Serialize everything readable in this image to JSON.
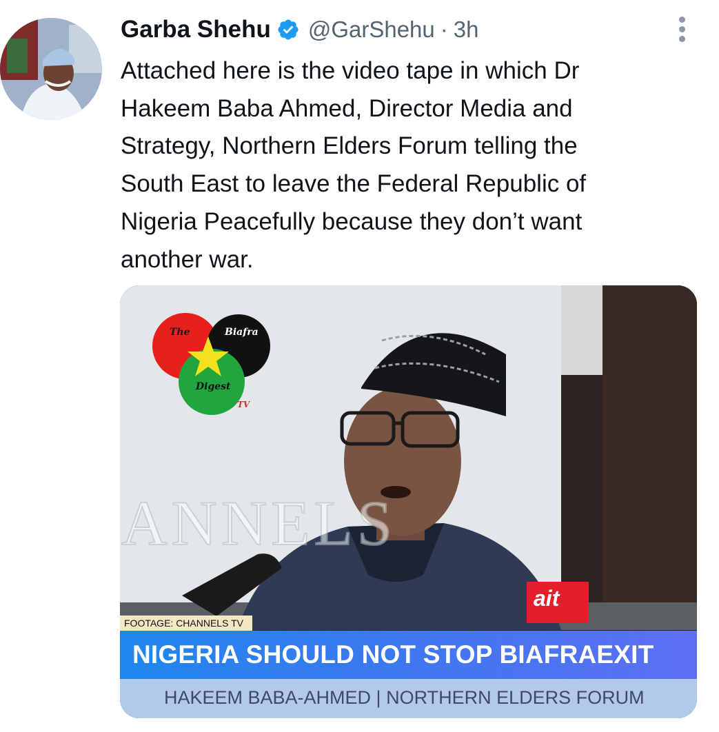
{
  "author": {
    "name": "Garba Shehu",
    "handle": "@GarShehu",
    "separator": "·",
    "time": "3h",
    "verified_icon": "verified-badge-icon"
  },
  "tweet": {
    "lines": [
      "Attached here is the video tape in which Dr",
      "Hakeem Baba Ahmed, Director Media and",
      "Strategy, Northern Elders Forum telling the",
      "South East to leave the Federal Republic of",
      "Nigeria Peacefully because they don’t want",
      "another war."
    ]
  },
  "media": {
    "logo": {
      "word_the": "The",
      "word_biafra": "Biafra",
      "word_digest": "Digest",
      "word_tv": "TV"
    },
    "watermark": "ANNELS",
    "mic_label": "ait",
    "footage_label": "FOOTAGE: CHANNELS TV",
    "headline": "NIGERIA SHOULD NOT STOP BIAFRAEXIT",
    "subheadline": "HAKEEM BABA-AHMED | NORTHERN ELDERS FORUM"
  },
  "icons": {
    "more": "more-options-icon"
  },
  "colors": {
    "verified": "#1d9bf0",
    "muted_text": "#536471",
    "logo_red": "#e8201c",
    "logo_black": "#111111",
    "logo_green": "#22a53f",
    "logo_star": "#f4e11d",
    "banner_blue": "#2f80ee"
  }
}
